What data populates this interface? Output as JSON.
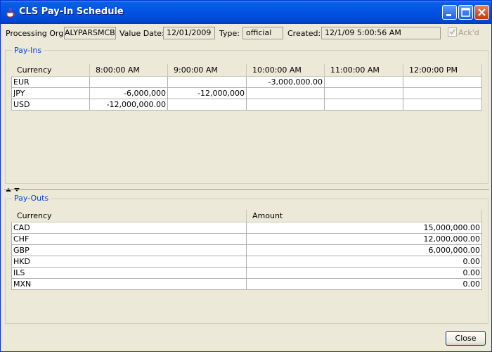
{
  "window": {
    "title": "CLS Pay-In Schedule"
  },
  "header": {
    "processing_org_label": "Processing Org:",
    "processing_org_value": "ALYPARSMCB",
    "value_date_label": "Value Date:",
    "value_date_value": "12/01/2009",
    "type_label": "Type:",
    "type_value": "official",
    "created_label": "Created:",
    "created_value": "12/1/09 5:00:56 AM",
    "ackd_label": "Ack'd",
    "ackd_checked": true
  },
  "payins": {
    "title": "Pay-Ins",
    "columns": [
      "Currency",
      "8:00:00 AM",
      "9:00:00 AM",
      "10:00:00 AM",
      "11:00:00 AM",
      "12:00:00 PM"
    ],
    "rows": [
      [
        "EUR",
        "",
        "",
        "-3,000,000.00",
        "",
        ""
      ],
      [
        "JPY",
        "-6,000,000",
        "-12,000,000",
        "",
        "",
        ""
      ],
      [
        "USD",
        "-12,000,000.00",
        "",
        "",
        "",
        ""
      ]
    ]
  },
  "payouts": {
    "title": "Pay-Outs",
    "columns": [
      "Currency",
      "Amount"
    ],
    "rows": [
      [
        "CAD",
        "15,000,000.00"
      ],
      [
        "CHF",
        "12,000,000.00"
      ],
      [
        "GBP",
        "6,000,000.00"
      ],
      [
        "HKD",
        "0.00"
      ],
      [
        "ILS",
        "0.00"
      ],
      [
        "MXN",
        "0.00"
      ]
    ]
  },
  "footer": {
    "close_label": "Close"
  },
  "colors": {
    "title_bar": "#0054e3",
    "group_title": "#0046d5",
    "window_bg": "#ece9d8"
  },
  "icons": [
    "java-cup-icon",
    "minimize-icon",
    "maximize-icon",
    "close-icon",
    "split-arrows-icon",
    "checkmark-icon"
  ]
}
